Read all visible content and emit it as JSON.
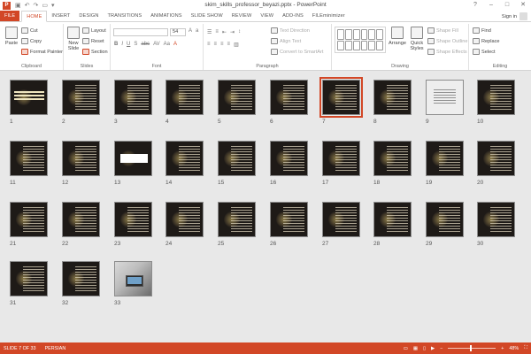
{
  "window": {
    "title": "skim_skills_professor_beyazi.pptx - PowerPoint",
    "app_icon_letter": "P",
    "controls": [
      "?",
      "–",
      "□",
      "✕"
    ]
  },
  "tabs": [
    {
      "label": "FILE",
      "kind": "file"
    },
    {
      "label": "HOME",
      "kind": "active"
    },
    {
      "label": "INSERT",
      "kind": ""
    },
    {
      "label": "DESIGN",
      "kind": ""
    },
    {
      "label": "TRANSITIONS",
      "kind": ""
    },
    {
      "label": "ANIMATIONS",
      "kind": ""
    },
    {
      "label": "SLIDE SHOW",
      "kind": ""
    },
    {
      "label": "REVIEW",
      "kind": ""
    },
    {
      "label": "VIEW",
      "kind": ""
    },
    {
      "label": "ADD-INS",
      "kind": ""
    },
    {
      "label": "FILEminimizer",
      "kind": ""
    }
  ],
  "signin": "Sign in",
  "ribbon": {
    "clipboard": {
      "label": "Clipboard",
      "paste": "Paste",
      "cut": "Cut",
      "copy": "Copy",
      "format_painter": "Format Painter"
    },
    "slides": {
      "label": "Slides",
      "new_slide": "New Slide",
      "layout": "Layout",
      "reset": "Reset",
      "section": "Section"
    },
    "font": {
      "label": "Font",
      "size": "54"
    },
    "paragraph": {
      "label": "Paragraph",
      "text_direction": "Text Direction",
      "align_text": "Align Text",
      "convert_smartart": "Convert to SmartArt"
    },
    "drawing": {
      "label": "Drawing",
      "arrange": "Arrange",
      "quick_styles": "Quick Styles",
      "shape_fill": "Shape Fill",
      "shape_outline": "Shape Outline",
      "shape_effects": "Shape Effects"
    },
    "editing": {
      "label": "Editing",
      "find": "Find",
      "replace": "Replace",
      "select": "Select"
    }
  },
  "slides": [
    {
      "num": "1",
      "style": "title"
    },
    {
      "num": "2",
      "style": "text"
    },
    {
      "num": "3",
      "style": "text"
    },
    {
      "num": "4",
      "style": "text"
    },
    {
      "num": "5",
      "style": "text"
    },
    {
      "num": "6",
      "style": "text"
    },
    {
      "num": "7",
      "style": "text",
      "selected": true
    },
    {
      "num": "8",
      "style": "text"
    },
    {
      "num": "9",
      "style": "light"
    },
    {
      "num": "10",
      "style": "text"
    },
    {
      "num": "11",
      "style": "text"
    },
    {
      "num": "12",
      "style": "text"
    },
    {
      "num": "13",
      "style": "whitebox"
    },
    {
      "num": "14",
      "style": "text"
    },
    {
      "num": "15",
      "style": "text"
    },
    {
      "num": "16",
      "style": "text"
    },
    {
      "num": "17",
      "style": "text"
    },
    {
      "num": "18",
      "style": "text"
    },
    {
      "num": "19",
      "style": "text"
    },
    {
      "num": "20",
      "style": "text"
    },
    {
      "num": "21",
      "style": "text"
    },
    {
      "num": "22",
      "style": "text"
    },
    {
      "num": "23",
      "style": "text"
    },
    {
      "num": "24",
      "style": "text"
    },
    {
      "num": "25",
      "style": "text"
    },
    {
      "num": "26",
      "style": "text"
    },
    {
      "num": "27",
      "style": "text"
    },
    {
      "num": "28",
      "style": "text"
    },
    {
      "num": "29",
      "style": "text"
    },
    {
      "num": "30",
      "style": "text"
    },
    {
      "num": "31",
      "style": "text"
    },
    {
      "num": "32",
      "style": "text"
    },
    {
      "num": "33",
      "style": "photo"
    }
  ],
  "status": {
    "slide_indicator": "SLIDE 7 OF 33",
    "language": "PERSIAN",
    "zoom": "48%",
    "zoom_fraction": 0.48
  },
  "colors": {
    "accent": "#d24726",
    "sorter_bg": "#e8e8e8"
  }
}
